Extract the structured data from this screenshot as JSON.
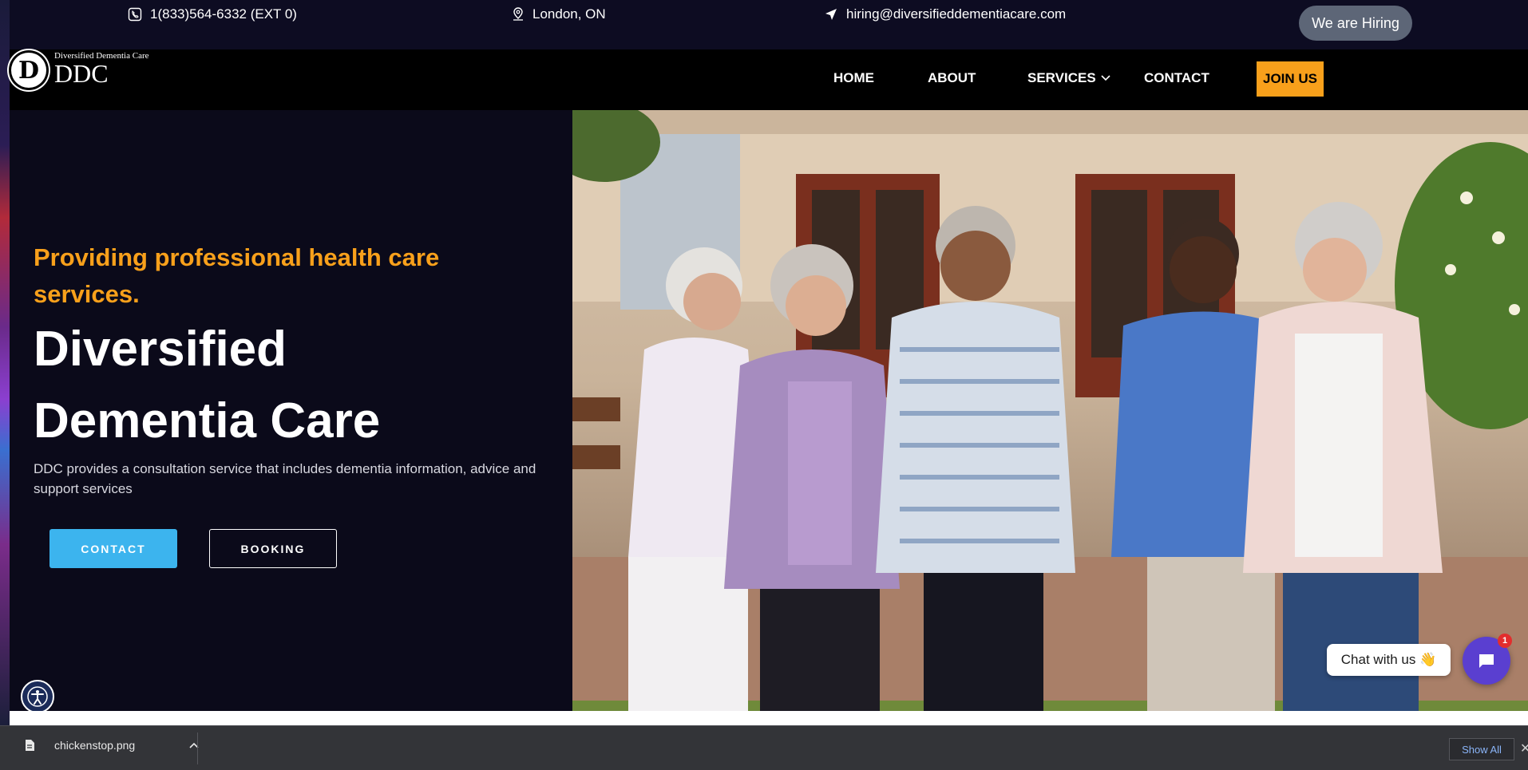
{
  "topbar": {
    "phone": "1(833)564-6332 (EXT 0)",
    "location": "London, ON",
    "email": "hiring@diversifieddementiacare.com",
    "hiring_label": "We are Hiring"
  },
  "logo": {
    "letter": "D",
    "small_text": "Diversified Dementia Care",
    "big_text": "DDC"
  },
  "nav": {
    "home": "HOME",
    "about": "ABOUT",
    "services": "SERVICES",
    "contact": "CONTACT",
    "join": "JOIN US"
  },
  "hero": {
    "tagline": "Providing professional health care services.",
    "headline_line1": "Diversified",
    "headline_line2": "Dementia Care",
    "description": "DDC provides a consultation service that includes dementia information, advice and support services",
    "contact_button": "CONTACT",
    "booking_button": "BOOKING"
  },
  "chat": {
    "prompt": "Chat with us 👋",
    "badge_count": "1"
  },
  "downloads": {
    "file_name": "chickenstop.png",
    "show_all": "Show All"
  },
  "colors": {
    "accent_orange": "#f8a01b",
    "contact_blue": "#3cb4ee",
    "chat_purple": "#5a3fd0",
    "navy": "#0b0a1a"
  }
}
